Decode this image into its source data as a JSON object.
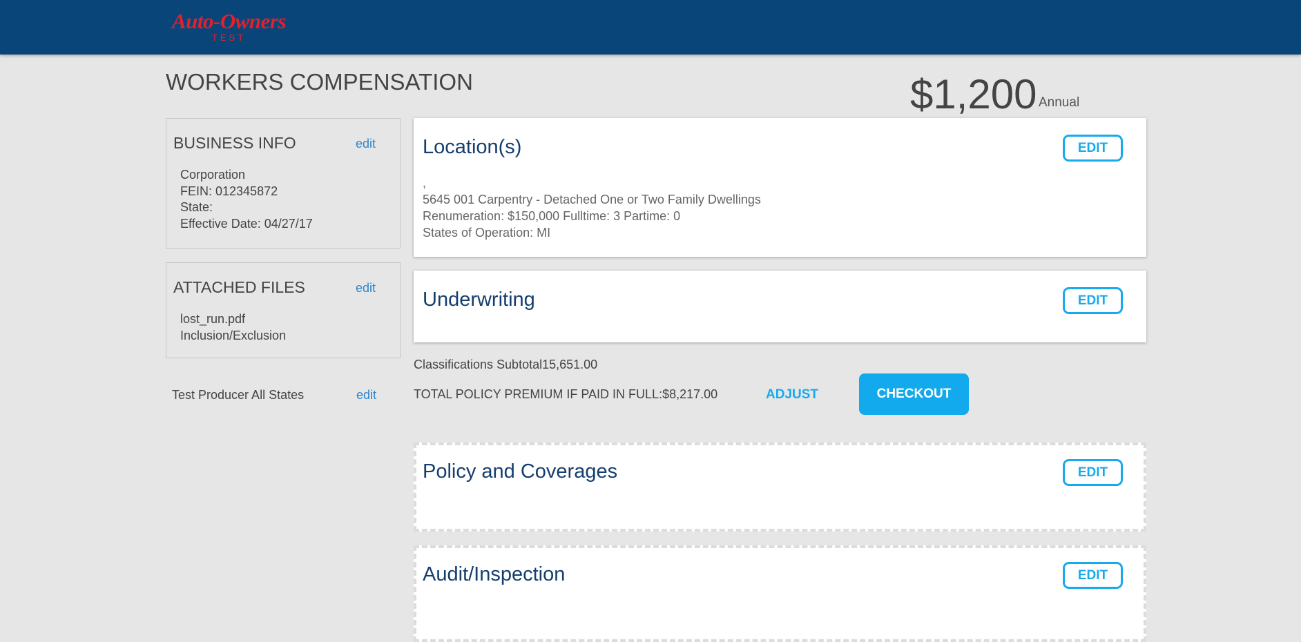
{
  "header": {
    "logo_text": "Auto-Owners",
    "logo_sub": "TEST"
  },
  "page_title": "WORKERS COMPENSATION",
  "price": {
    "amount": "$1,200",
    "period": "Annual"
  },
  "sidebar": {
    "business_info": {
      "title": "BUSINESS INFO",
      "edit": "edit",
      "lines": [
        "Corporation",
        "FEIN: 012345872",
        "State:",
        "Effective Date: 04/27/17"
      ]
    },
    "attached_files": {
      "title": "ATTACHED FILES",
      "edit": "edit",
      "files": [
        "lost_run.pdf",
        "Inclusion/Exclusion"
      ]
    },
    "producer": {
      "name": "Test Producer All States",
      "edit": "edit"
    }
  },
  "cards": {
    "locations": {
      "title": "Location(s)",
      "edit": "EDIT",
      "lines": [
        ",",
        "5645 001 Carpentry - Detached One or Two Family Dwellings",
        "Renumeration: $150,000 Fulltime: 3 Partime: 0",
        "States of Operation: MI"
      ]
    },
    "underwriting": {
      "title": "Underwriting",
      "edit": "EDIT"
    },
    "policy": {
      "title": "Policy and Coverages",
      "edit": "EDIT"
    },
    "audit": {
      "title": "Audit/Inspection",
      "edit": "EDIT"
    }
  },
  "summary": {
    "subtotal": "Classifications Subtotal15,651.00",
    "total": "TOTAL POLICY PREMIUM IF PAID IN FULL:$8,217.00",
    "adjust": "ADJUST",
    "checkout": "CHECKOUT"
  }
}
